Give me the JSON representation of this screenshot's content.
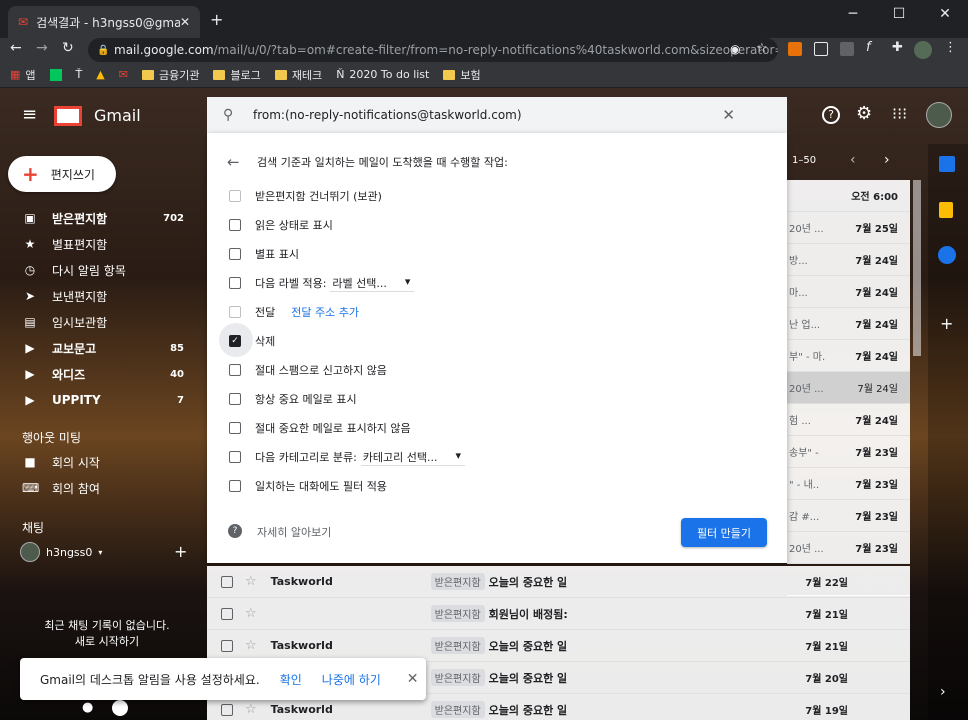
{
  "browser": {
    "tab_title": "검색결과 - h3ngss0@gmail.com",
    "url_host": "mail.google.com",
    "url_path": "/mail/u/0/?tab=om#create-filter/from=no-reply-notifications%40taskworld.com&sizeoperator=s_sl&...",
    "bookmarks": [
      "앱",
      "금융기관",
      "블로그",
      "재테크",
      "2020 To do list",
      "보험"
    ]
  },
  "gmail": {
    "logo": "Gmail",
    "compose": "편지쓰기",
    "pager": "1–50",
    "nav": [
      {
        "label": "받은편지함",
        "count": "702",
        "icon": "inbox-icon"
      },
      {
        "label": "별표편지함",
        "count": "",
        "icon": "star-icon"
      },
      {
        "label": "다시 알림 항목",
        "count": "",
        "icon": "clock-icon"
      },
      {
        "label": "보낸편지함",
        "count": "",
        "icon": "send-icon"
      },
      {
        "label": "임시보관함",
        "count": "",
        "icon": "draft-icon"
      },
      {
        "label": "교보문고",
        "count": "85",
        "icon": "label-icon"
      },
      {
        "label": "와디즈",
        "count": "40",
        "icon": "label-icon"
      },
      {
        "label": "UPPITY",
        "count": "7",
        "icon": "label-icon"
      }
    ],
    "hangouts_title": "행아웃 미팅",
    "hangouts": [
      "회의 시작",
      "회의 참여"
    ],
    "chat_title": "채팅",
    "chat_user": "h3ngss0",
    "chat_empty": "최근 채팅 기록이 없습니다.",
    "chat_start": "새로 시작하기"
  },
  "filter": {
    "query": "from:(no-reply-notifications@taskworld.com)",
    "heading": "검색 기준과 일치하는 메일이 도착했을 때 수행할 작업:",
    "options": [
      {
        "label": "받은편지함 건너뛰기 (보관)",
        "checked": false,
        "disabled": true
      },
      {
        "label": "읽은 상태로 표시",
        "checked": false,
        "disabled": false
      },
      {
        "label": "별표 표시",
        "checked": false,
        "disabled": false
      },
      {
        "label": "다음 라벨 적용:",
        "checked": false,
        "disabled": false,
        "select": "라벨 선택..."
      },
      {
        "label": "전달",
        "checked": false,
        "disabled": true,
        "link": "전달 주소 추가"
      },
      {
        "label": "삭제",
        "checked": true,
        "disabled": false
      },
      {
        "label": "절대 스팸으로 신고하지 않음",
        "checked": false,
        "disabled": false
      },
      {
        "label": "항상 중요 메일로 표시",
        "checked": false,
        "disabled": false
      },
      {
        "label": "절대 중요한 메일로 표시하지 않음",
        "checked": false,
        "disabled": false
      },
      {
        "label": "다음 카테고리로 분류:",
        "checked": false,
        "disabled": false,
        "select": "카테고리 선택..."
      },
      {
        "label": "일치하는 대화에도 필터 적용",
        "checked": false,
        "disabled": false
      }
    ],
    "learn_more": "자세히 알아보기",
    "create_button": "필터 만들기"
  },
  "list_rows": [
    {
      "sender": "Taskworld",
      "tag": "받은편지함",
      "subject": "오늘의 중요한 일",
      "date": "7월 22일"
    },
    {
      "sender": "",
      "tag": "받은편지함",
      "subject": "회원님이 배정됨:",
      "date": "7월 21일"
    },
    {
      "sender": "Taskworld",
      "tag": "받은편지함",
      "subject": "오늘의 중요한 일",
      "date": "7월 21일"
    },
    {
      "sender": "Taskworld",
      "tag": "받은편지함",
      "subject": "오늘의 중요한 일",
      "date": "7월 20일"
    },
    {
      "sender": "Taskworld",
      "tag": "받은편지함",
      "subject": "오늘의 중요한 일",
      "date": "7월 19일"
    }
  ],
  "right_dates": [
    "오전 6:00",
    "7월 25일",
    "7월 24일",
    "7월 24일",
    "7월 24일",
    "7월 24일",
    "7월 24일",
    "7월 24일",
    "7월 23일",
    "7월 23일",
    "7월 23일",
    "7월 23일",
    "7월 23일"
  ],
  "right_snips": [
    "20년 ...",
    "20년 ...",
    "방...",
    "마...",
    "난 업...",
    "부\" - 마.",
    "20년 ...",
    "험 ...",
    "송부\" -",
    "\" - 내..",
    "감 #...",
    "20년 ..."
  ],
  "snackbar": {
    "text": "Gmail의 데스크톱 알림을 사용 설정하세요.",
    "ok": "확인",
    "later": "나중에 하기"
  }
}
